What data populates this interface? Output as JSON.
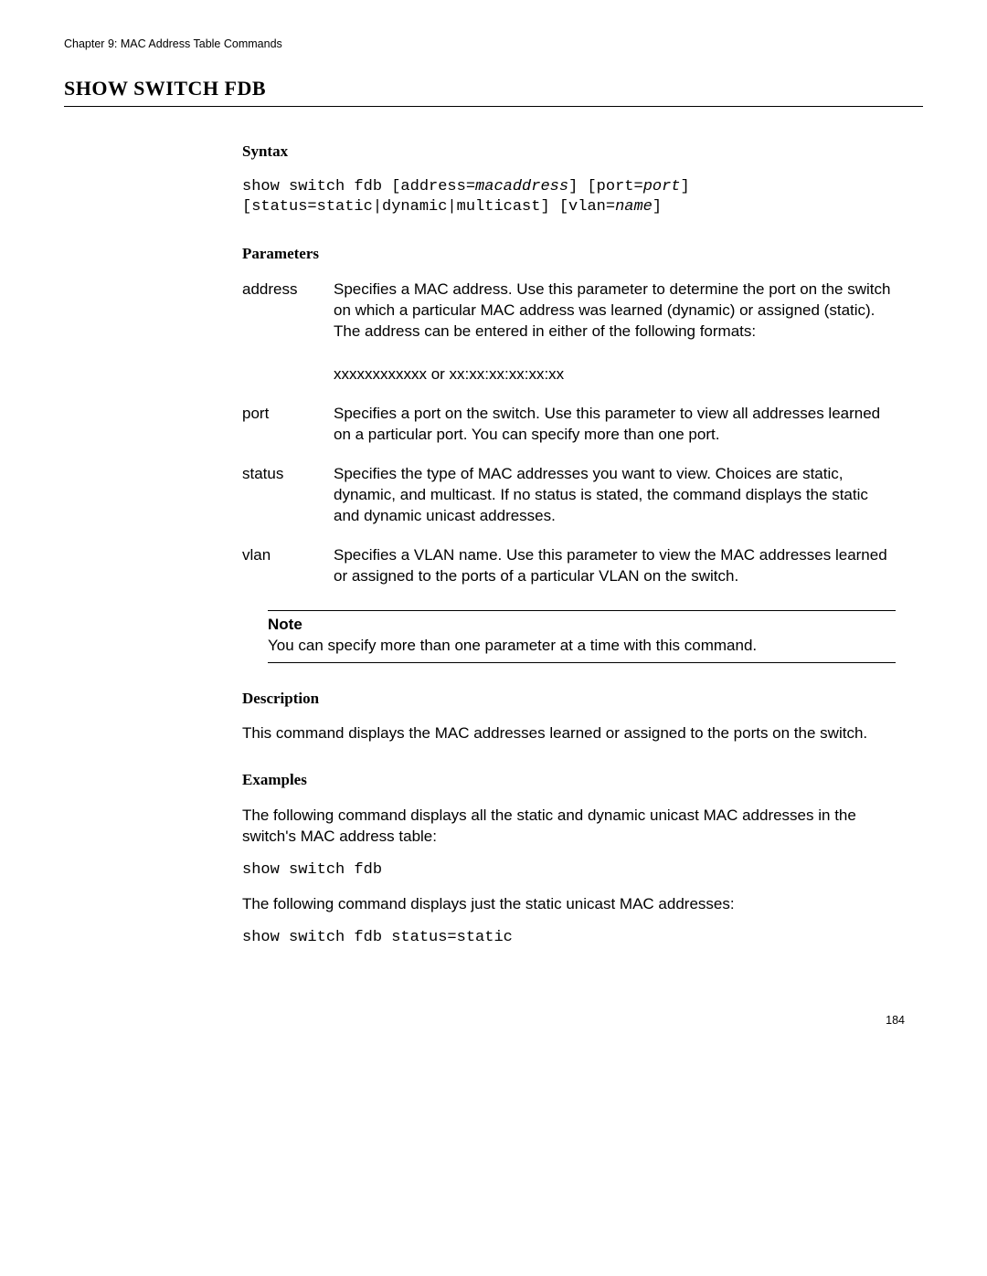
{
  "chapter_header": "Chapter 9: MAC Address Table Commands",
  "title": "SHOW SWITCH FDB",
  "syntax_label": "Syntax",
  "syntax_line1_a": "show switch fdb [address=",
  "syntax_line1_b": "macaddress",
  "syntax_line1_c": "] [port=",
  "syntax_line1_d": "port",
  "syntax_line1_e": "]",
  "syntax_line2_a": "[status=static|dynamic|multicast] [vlan=",
  "syntax_line2_b": "name",
  "syntax_line2_c": "]",
  "parameters_label": "Parameters",
  "params": {
    "address": {
      "name": "address",
      "desc": "Specifies a MAC address. Use this parameter to determine the port on the switch on which a particular MAC address was learned (dynamic) or assigned (static). The address can be entered in either of the following formats:",
      "format": "xxxxxxxxxxxx or xx:xx:xx:xx:xx:xx"
    },
    "port": {
      "name": "port",
      "desc": "Specifies a port on the switch. Use this parameter to view all addresses learned on a particular port. You can specify more than one port."
    },
    "status": {
      "name": "status",
      "desc": "Specifies the type of MAC addresses you want to view. Choices are static, dynamic, and multicast. If no status is stated, the command displays the static and dynamic unicast addresses."
    },
    "vlan": {
      "name": "vlan",
      "desc": "Specifies a VLAN name. Use this parameter to view the MAC addresses learned or assigned to the ports of a particular VLAN on the switch."
    }
  },
  "note_label": "Note",
  "note_text": "You can specify more than one parameter at a time with this command.",
  "description_label": "Description",
  "description_text": "This command displays the MAC addresses learned or assigned to the ports on the switch.",
  "examples_label": "Examples",
  "example1_text": "The following command displays all the static and dynamic unicast MAC addresses in the switch's MAC address table:",
  "example1_code": "show switch fdb",
  "example2_text": "The following command displays just the static unicast MAC addresses:",
  "example2_code": "show switch fdb status=static",
  "page_number": "184"
}
